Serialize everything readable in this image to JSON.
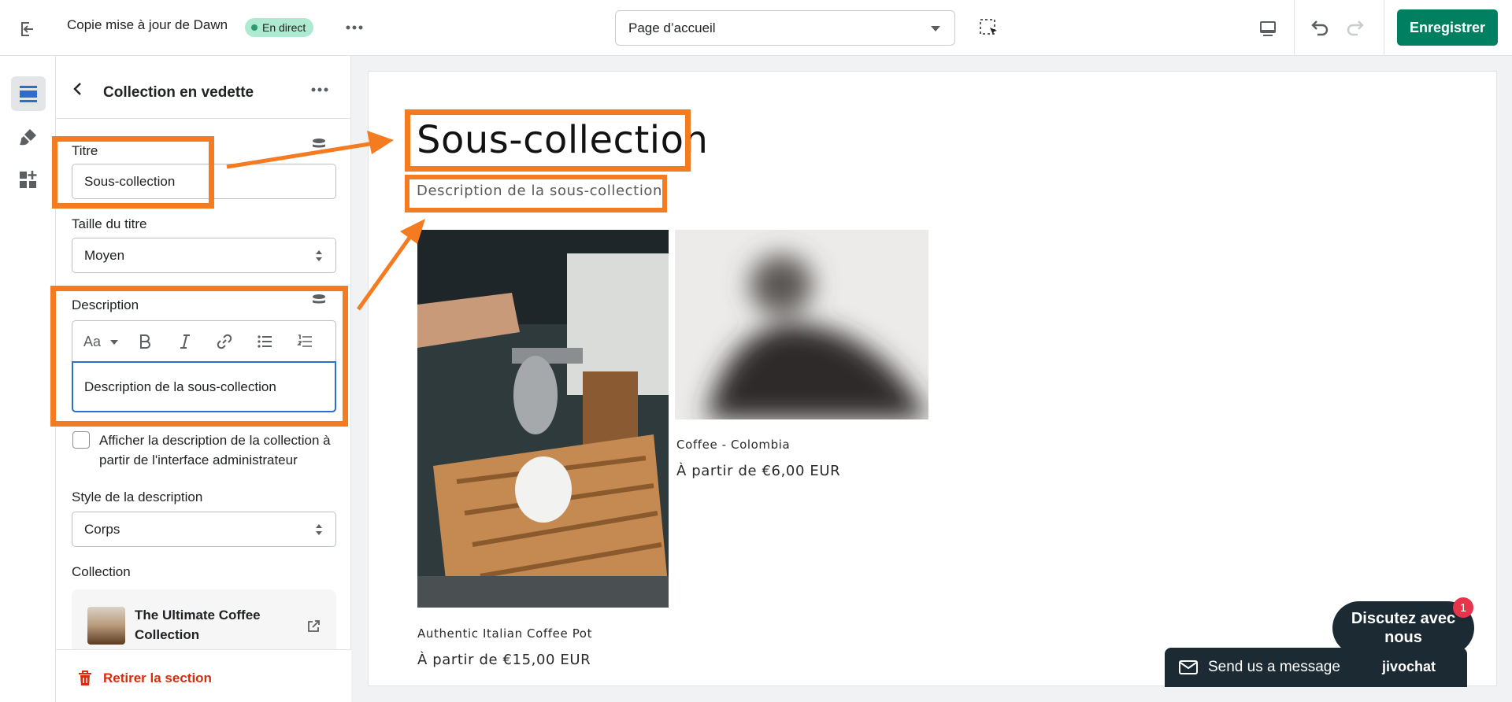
{
  "topbar": {
    "theme_name": "Copie mise à jour de Dawn",
    "status": "En direct",
    "page_selector": "Page d’accueil",
    "save_label": "Enregistrer"
  },
  "panel": {
    "title": "Collection en vedette",
    "title_field": {
      "label": "Titre",
      "value": "Sous-collection"
    },
    "title_size": {
      "label": "Taille du titre",
      "value": "Moyen"
    },
    "description": {
      "label": "Description",
      "value": "Description de la sous-collection"
    },
    "show_description": "Afficher la description de la collection à partir de l'interface administrateur",
    "description_style": {
      "label": "Style de la description",
      "value": "Corps"
    },
    "collection": {
      "label": "Collection",
      "name": "The Ultimate Coffee Collection"
    },
    "remove_label": "Retirer la section"
  },
  "preview": {
    "heading": "Sous-collection",
    "description": "Description de la sous-collection",
    "products": [
      {
        "name": "Authentic Italian Coffee Pot",
        "price": "À partir de €15,00 EUR"
      },
      {
        "name": "Coffee - Colombia",
        "price": "À partir de €6,00 EUR"
      }
    ]
  },
  "chat": {
    "bubble": "Discutez avec nous",
    "badge": "1",
    "bar_message": "Send us a message",
    "brand": "jivochat"
  },
  "colors": {
    "primary": "#008060",
    "highlight": "#f47b20",
    "live_badge": "#aee9d1",
    "danger": "#d82c0d"
  }
}
